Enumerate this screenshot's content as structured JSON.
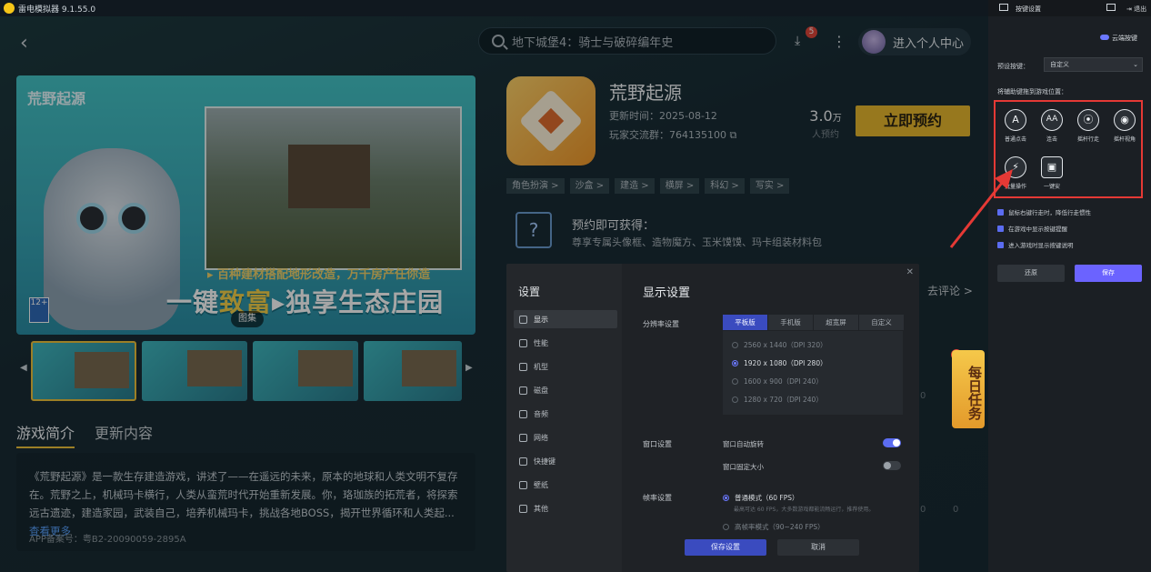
{
  "app": {
    "title": "雷电模拟器 9.1.55.0"
  },
  "header": {
    "search_placeholder": "地下城堡4：骑士与破碎编年史",
    "download_badge": "5",
    "user_center": "进入个人中心"
  },
  "hero": {
    "logo_text": "荒野起源",
    "line1": "▸ 百种建材搭配地形改造，万千房产任你造",
    "line2_a": "一键",
    "line2_b": "致富",
    "line2_c": "▸独享生态庄园",
    "age": "12+",
    "gallery": "图集"
  },
  "tabs": [
    "游戏简介",
    "更新内容"
  ],
  "description": {
    "text": "《荒野起源》是一款生存建造游戏，讲述了——在遥远的未来，原本的地球和人类文明不复存在。荒野之上，机械玛卡横行，人类从蛮荒时代开始重新发展。你，珞珈族的拓荒者，将探索远古遗迹，建造家园，武装自己，培养机械玛卡，挑战各地BOSS，揭开世界循环和人类起...",
    "more": "查看更多",
    "filing": "APP备案号：粤B2-20090059-2895A"
  },
  "game": {
    "title": "荒野起源",
    "update_time": "更新时间：2025-08-12",
    "player_group": "玩家交流群：764135100",
    "reserve_count": "3.0",
    "reserve_unit": "万",
    "reserve_label": "人预约",
    "reserve_button": "立即预约",
    "tags": [
      "角色扮演 >",
      "沙盒 >",
      "建造 >",
      "横屏 >",
      "科幻 >",
      "写实 >"
    ],
    "reward_title": "预约即可获得：",
    "reward_sub": "尊享专属头像框、造物魔方、玉米馍馍、玛卡组装材料包",
    "comment_link": "去评论 >",
    "daily_task": "每日任务",
    "stat_zero": "0"
  },
  "settings": {
    "side_title": "设置",
    "side_items": [
      "显示",
      "性能",
      "机型",
      "磁盘",
      "音频",
      "网络",
      "快捷键",
      "壁纸",
      "其他"
    ],
    "title": "显示设置",
    "resolution_label": "分辨率设置",
    "res_tabs": [
      "平板版",
      "手机版",
      "超宽屏",
      "自定义"
    ],
    "res_options": [
      "2560 x 1440（DPI 320）",
      "1920 x 1080（DPI 280）",
      "1600 x 900（DPI 240）",
      "1280 x 720（DPI 240）"
    ],
    "window_label": "窗口设置",
    "auto_rotate": "窗口自动旋转",
    "fixed_size": "窗口固定大小",
    "fps_label": "帧率设置",
    "fps_normal": "普通模式（60 FPS）",
    "fps_hint": "最高可达 60 FPS，大多数游戏都能流畅运行，推荐使用。",
    "fps_high": "高帧率模式（90~240 FPS）",
    "save": "保存设置",
    "cancel": "取消"
  },
  "keypanel": {
    "title": "按键设置",
    "exit": "退出",
    "cloud": "云端按键",
    "preset_label": "预设按键：",
    "preset_value": "自定义",
    "drag_hint": "将辅助键拖到游戏位置：",
    "keys": [
      {
        "glyph": "A",
        "label": "普通点击"
      },
      {
        "glyph": "AA",
        "label": "连击"
      },
      {
        "glyph": "⦿",
        "label": "摇杆行走"
      },
      {
        "glyph": "◉",
        "label": "摇杆视角"
      },
      {
        "glyph": "⚡",
        "label": "批量操作"
      },
      {
        "glyph": "▣",
        "label": "一键安"
      }
    ],
    "checks": [
      "鼠标右键行走时，降低行走惯性",
      "在游戏中显示按键提醒",
      "进入游戏时显示按键说明"
    ],
    "reset": "还原",
    "save": "保存"
  },
  "colors": {
    "accent": "#6b63ff",
    "highlight": "#e53935",
    "reserve": "#e8b92e"
  }
}
